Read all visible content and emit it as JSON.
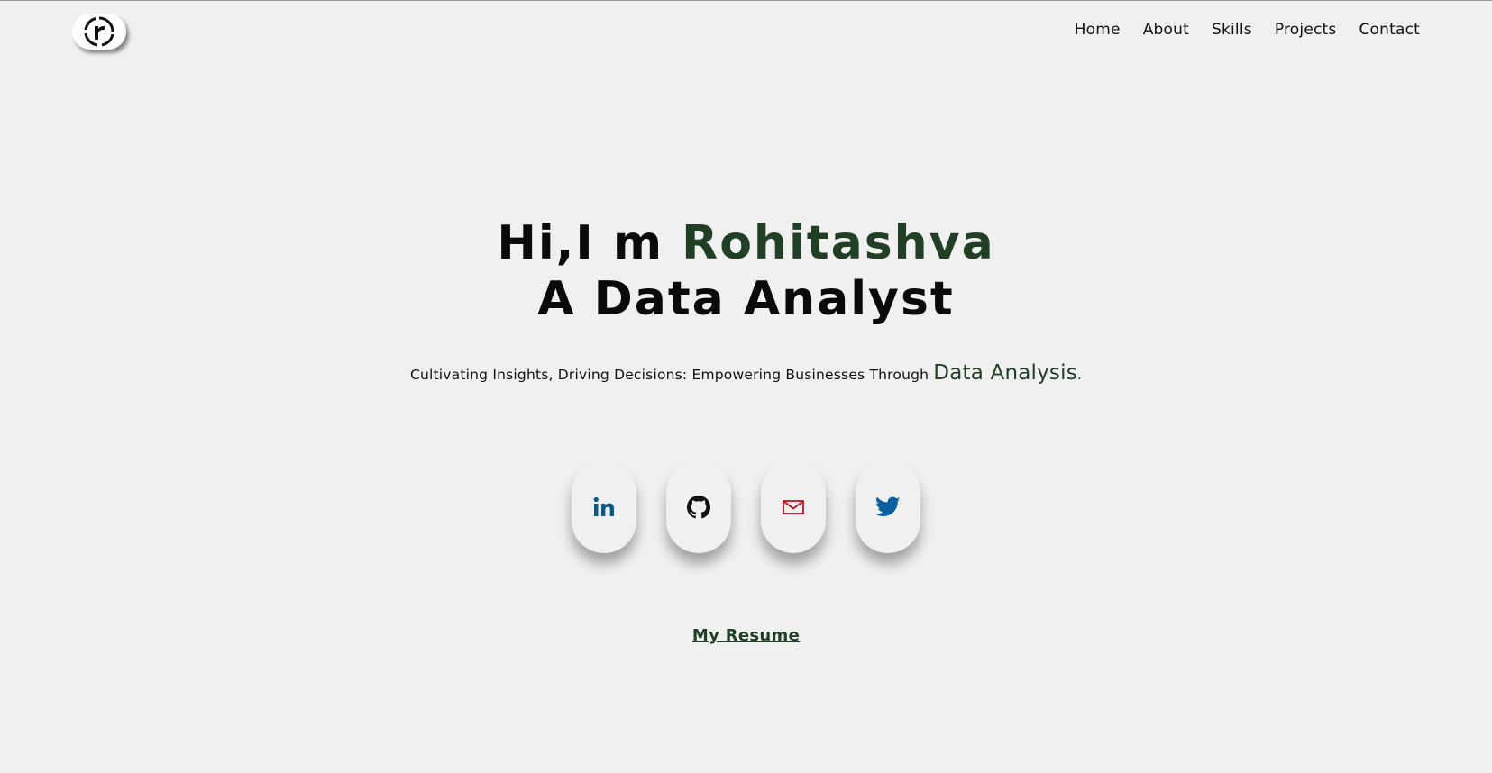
{
  "brand": {
    "logo_icon": "r-logo-icon"
  },
  "nav": {
    "items": [
      {
        "label": "Home"
      },
      {
        "label": "About"
      },
      {
        "label": "Skills"
      },
      {
        "label": "Projects"
      },
      {
        "label": "Contact"
      }
    ]
  },
  "hero": {
    "greeting": "Hi,I m ",
    "name": "Rohitashva",
    "role": "A Data Analyst",
    "tagline_prefix": "Cultivating Insights, Driving Decisions: Empowering Businesses Through ",
    "tagline_highlight": "Data Analysis",
    "tagline_suffix": "."
  },
  "socials": [
    {
      "icon": "linkedin-icon",
      "color": "#0a5a8c"
    },
    {
      "icon": "github-icon",
      "color": "#111111"
    },
    {
      "icon": "mail-icon",
      "color": "#c0121f"
    },
    {
      "icon": "twitter-icon",
      "color": "#0a5fa0"
    }
  ],
  "resume": {
    "label": "My Resume"
  },
  "colors": {
    "background": "#f0f0f0",
    "accent": "#213f25",
    "text": "#0a0a0a"
  }
}
